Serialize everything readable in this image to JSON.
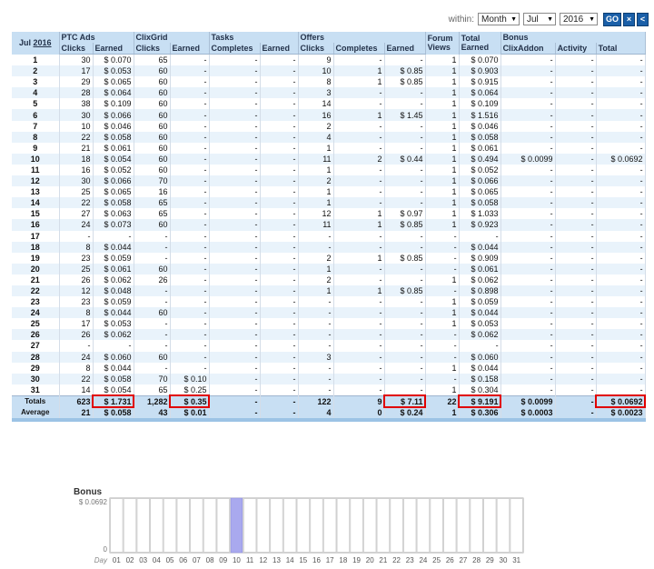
{
  "filter": {
    "within_label": "within:",
    "period": "Month",
    "month": "Jul",
    "year": "2016",
    "go_label": "GO",
    "close_label": "×",
    "back_label": "<"
  },
  "header": {
    "month": "Jul",
    "year": "2016",
    "groups": {
      "ptc": "PTC Ads",
      "clixgrid": "ClixGrid",
      "tasks": "Tasks",
      "offers": "Offers",
      "forum": "Forum Views",
      "total": "Total Earned",
      "bonus": "Bonus"
    },
    "sub": {
      "clicks": "Clicks",
      "earned": "Earned",
      "completes": "Completes",
      "clixaddon": "ClixAddon",
      "activity": "Activity",
      "total": "Total"
    }
  },
  "rows": [
    [
      "1",
      "30",
      "$ 0.070",
      "65",
      "-",
      "-",
      "-",
      "9",
      "-",
      "-",
      "1",
      "$ 0.070",
      "-",
      "-",
      "-"
    ],
    [
      "2",
      "17",
      "$ 0.053",
      "60",
      "-",
      "-",
      "-",
      "10",
      "1",
      "$ 0.85",
      "1",
      "$ 0.903",
      "-",
      "-",
      "-"
    ],
    [
      "3",
      "29",
      "$ 0.065",
      "60",
      "-",
      "-",
      "-",
      "8",
      "1",
      "$ 0.85",
      "1",
      "$ 0.915",
      "-",
      "-",
      "-"
    ],
    [
      "4",
      "28",
      "$ 0.064",
      "60",
      "-",
      "-",
      "-",
      "3",
      "-",
      "-",
      "1",
      "$ 0.064",
      "-",
      "-",
      "-"
    ],
    [
      "5",
      "38",
      "$ 0.109",
      "60",
      "-",
      "-",
      "-",
      "14",
      "-",
      "-",
      "1",
      "$ 0.109",
      "-",
      "-",
      "-"
    ],
    [
      "6",
      "30",
      "$ 0.066",
      "60",
      "-",
      "-",
      "-",
      "16",
      "1",
      "$ 1.45",
      "1",
      "$ 1.516",
      "-",
      "-",
      "-"
    ],
    [
      "7",
      "10",
      "$ 0.046",
      "60",
      "-",
      "-",
      "-",
      "2",
      "-",
      "-",
      "1",
      "$ 0.046",
      "-",
      "-",
      "-"
    ],
    [
      "8",
      "22",
      "$ 0.058",
      "60",
      "-",
      "-",
      "-",
      "4",
      "-",
      "-",
      "1",
      "$ 0.058",
      "-",
      "-",
      "-"
    ],
    [
      "9",
      "21",
      "$ 0.061",
      "60",
      "-",
      "-",
      "-",
      "1",
      "-",
      "-",
      "1",
      "$ 0.061",
      "-",
      "-",
      "-"
    ],
    [
      "10",
      "18",
      "$ 0.054",
      "60",
      "-",
      "-",
      "-",
      "11",
      "2",
      "$ 0.44",
      "1",
      "$ 0.494",
      "$ 0.0099",
      "-",
      "$ 0.0692"
    ],
    [
      "11",
      "16",
      "$ 0.052",
      "60",
      "-",
      "-",
      "-",
      "1",
      "-",
      "-",
      "1",
      "$ 0.052",
      "-",
      "-",
      "-"
    ],
    [
      "12",
      "30",
      "$ 0.066",
      "70",
      "-",
      "-",
      "-",
      "2",
      "-",
      "-",
      "1",
      "$ 0.066",
      "-",
      "-",
      "-"
    ],
    [
      "13",
      "25",
      "$ 0.065",
      "16",
      "-",
      "-",
      "-",
      "1",
      "-",
      "-",
      "1",
      "$ 0.065",
      "-",
      "-",
      "-"
    ],
    [
      "14",
      "22",
      "$ 0.058",
      "65",
      "-",
      "-",
      "-",
      "1",
      "-",
      "-",
      "1",
      "$ 0.058",
      "-",
      "-",
      "-"
    ],
    [
      "15",
      "27",
      "$ 0.063",
      "65",
      "-",
      "-",
      "-",
      "12",
      "1",
      "$ 0.97",
      "1",
      "$ 1.033",
      "-",
      "-",
      "-"
    ],
    [
      "16",
      "24",
      "$ 0.073",
      "60",
      "-",
      "-",
      "-",
      "11",
      "1",
      "$ 0.85",
      "1",
      "$ 0.923",
      "-",
      "-",
      "-"
    ],
    [
      "17",
      "-",
      "-",
      "-",
      "-",
      "-",
      "-",
      "-",
      "-",
      "-",
      "-",
      "-",
      "-",
      "-",
      "-"
    ],
    [
      "18",
      "8",
      "$ 0.044",
      "-",
      "-",
      "-",
      "-",
      "-",
      "-",
      "-",
      "-",
      "$ 0.044",
      "-",
      "-",
      "-"
    ],
    [
      "19",
      "23",
      "$ 0.059",
      "-",
      "-",
      "-",
      "-",
      "2",
      "1",
      "$ 0.85",
      "-",
      "$ 0.909",
      "-",
      "-",
      "-"
    ],
    [
      "20",
      "25",
      "$ 0.061",
      "60",
      "-",
      "-",
      "-",
      "1",
      "-",
      "-",
      "-",
      "$ 0.061",
      "-",
      "-",
      "-"
    ],
    [
      "21",
      "26",
      "$ 0.062",
      "26",
      "-",
      "-",
      "-",
      "2",
      "-",
      "-",
      "1",
      "$ 0.062",
      "-",
      "-",
      "-"
    ],
    [
      "22",
      "12",
      "$ 0.048",
      "-",
      "-",
      "-",
      "-",
      "1",
      "1",
      "$ 0.85",
      "-",
      "$ 0.898",
      "-",
      "-",
      "-"
    ],
    [
      "23",
      "23",
      "$ 0.059",
      "-",
      "-",
      "-",
      "-",
      "-",
      "-",
      "-",
      "1",
      "$ 0.059",
      "-",
      "-",
      "-"
    ],
    [
      "24",
      "8",
      "$ 0.044",
      "60",
      "-",
      "-",
      "-",
      "-",
      "-",
      "-",
      "1",
      "$ 0.044",
      "-",
      "-",
      "-"
    ],
    [
      "25",
      "17",
      "$ 0.053",
      "-",
      "-",
      "-",
      "-",
      "-",
      "-",
      "-",
      "1",
      "$ 0.053",
      "-",
      "-",
      "-"
    ],
    [
      "26",
      "26",
      "$ 0.062",
      "-",
      "-",
      "-",
      "-",
      "-",
      "-",
      "-",
      "-",
      "$ 0.062",
      "-",
      "-",
      "-"
    ],
    [
      "27",
      "-",
      "-",
      "-",
      "-",
      "-",
      "-",
      "-",
      "-",
      "-",
      "-",
      "-",
      "-",
      "-",
      "-"
    ],
    [
      "28",
      "24",
      "$ 0.060",
      "60",
      "-",
      "-",
      "-",
      "3",
      "-",
      "-",
      "-",
      "$ 0.060",
      "-",
      "-",
      "-"
    ],
    [
      "29",
      "8",
      "$ 0.044",
      "-",
      "-",
      "-",
      "-",
      "-",
      "-",
      "-",
      "1",
      "$ 0.044",
      "-",
      "-",
      "-"
    ],
    [
      "30",
      "22",
      "$ 0.058",
      "70",
      "$ 0.10",
      "-",
      "-",
      "-",
      "-",
      "-",
      "-",
      "$ 0.158",
      "-",
      "-",
      "-"
    ],
    [
      "31",
      "14",
      "$ 0.054",
      "65",
      "$ 0.25",
      "-",
      "-",
      "-",
      "-",
      "-",
      "1",
      "$ 0.304",
      "-",
      "-",
      "-"
    ]
  ],
  "totals": {
    "label": "Totals",
    "values": [
      "623",
      "$ 1.731",
      "1,282",
      "$ 0.35",
      "-",
      "-",
      "122",
      "9",
      "$ 7.11",
      "22",
      "$ 9.191",
      "$ 0.0099",
      "-",
      "$ 0.0692"
    ]
  },
  "average": {
    "label": "Average",
    "values": [
      "21",
      "$ 0.058",
      "43",
      "$ 0.01",
      "-",
      "-",
      "4",
      "0",
      "$ 0.24",
      "1",
      "$ 0.306",
      "$ 0.0003",
      "-",
      "$ 0.0023"
    ]
  },
  "colors": {
    "header_bg": "#c8dff3",
    "row_alt": "#e9f3fb",
    "highlight": "#e00000",
    "bar": "#a9a9ee",
    "button": "#1a5fa8"
  },
  "chart_data": {
    "type": "bar",
    "title": "Bonus",
    "xlabel": "Day",
    "ylabel": "",
    "categories": [
      "01",
      "02",
      "03",
      "04",
      "05",
      "06",
      "07",
      "08",
      "09",
      "10",
      "11",
      "12",
      "13",
      "14",
      "15",
      "16",
      "17",
      "18",
      "19",
      "20",
      "21",
      "22",
      "23",
      "24",
      "25",
      "26",
      "27",
      "28",
      "29",
      "30",
      "31"
    ],
    "values": [
      0,
      0,
      0,
      0,
      0,
      0,
      0,
      0,
      0,
      0.0692,
      0,
      0,
      0,
      0,
      0,
      0,
      0,
      0,
      0,
      0,
      0,
      0,
      0,
      0,
      0,
      0,
      0,
      0,
      0,
      0,
      0
    ],
    "ytick_labels": [
      "$ 0.0692",
      "0"
    ],
    "ylim": [
      0,
      0.0692
    ]
  }
}
